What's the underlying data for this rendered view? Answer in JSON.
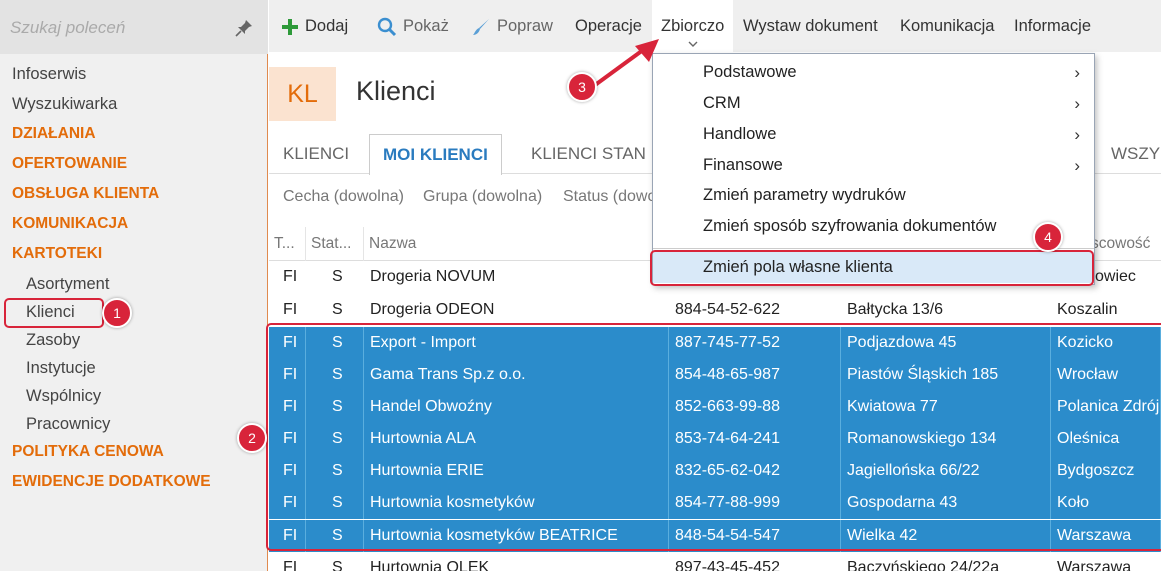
{
  "search": {
    "placeholder": "Szukaj poleceń"
  },
  "sidebar": {
    "items": [
      {
        "label": "Infoserwis"
      },
      {
        "label": "Wyszukiwarka"
      },
      {
        "label": "DZIAŁANIA"
      },
      {
        "label": "OFERTOWANIE"
      },
      {
        "label": "OBSŁUGA KLIENTA"
      },
      {
        "label": "KOMUNIKACJA"
      },
      {
        "label": "KARTOTEKI"
      },
      {
        "label": "Asortyment"
      },
      {
        "label": "Klienci"
      },
      {
        "label": "Zasoby"
      },
      {
        "label": "Instytucje"
      },
      {
        "label": "Wspólnicy"
      },
      {
        "label": "Pracownicy"
      },
      {
        "label": "POLITYKA CENOWA"
      },
      {
        "label": "EWIDENCJE DODATKOWE"
      }
    ]
  },
  "toolbar": {
    "dodaj": "Dodaj",
    "pokaz": "Pokaż",
    "popraw": "Popraw",
    "operacje": "Operacje",
    "zbiorczo": "Zbiorczo",
    "wystaw": "Wystaw dokument",
    "komunikacja": "Komunikacja",
    "informacje": "Informacje"
  },
  "header": {
    "badge": "KL",
    "title": "Klienci"
  },
  "tabs": [
    {
      "label": "KLIENCI"
    },
    {
      "label": "MOI KLIENCI"
    },
    {
      "label": "KLIENCI STAN"
    },
    {
      "label": "WSZY"
    }
  ],
  "filters": [
    {
      "label": "Cecha (dowolna)"
    },
    {
      "label": "Grupa (dowolna)"
    },
    {
      "label": "Status (dowo"
    }
  ],
  "grid": {
    "columns": [
      "T...",
      "Stat...",
      "Nazwa",
      "",
      "",
      "scowość"
    ],
    "rows": [
      {
        "typ": "FI",
        "status": "S",
        "nazwa": "Drogeria NOVUM",
        "nip": "",
        "adres": "",
        "miejscowosc": "owiec"
      },
      {
        "typ": "FI",
        "status": "S",
        "nazwa": "Drogeria ODEON",
        "nip": "884-54-52-622",
        "adres": "Bałtycka  13/6",
        "miejscowosc": "Koszalin"
      },
      {
        "typ": "FI",
        "status": "S",
        "nazwa": "Export - Import",
        "nip": "887-745-77-52",
        "adres": "Podjazdowa 45",
        "miejscowosc": "Kozicko"
      },
      {
        "typ": "FI",
        "status": "S",
        "nazwa": "Gama Trans Sp.z o.o.",
        "nip": "854-48-65-987",
        "adres": "Piastów Śląskich 185",
        "miejscowosc": "Wrocław"
      },
      {
        "typ": "FI",
        "status": "S",
        "nazwa": "Handel Obwoźny",
        "nip": "852-663-99-88",
        "adres": "Kwiatowa  77",
        "miejscowosc": "Polanica Zdrój"
      },
      {
        "typ": "FI",
        "status": "S",
        "nazwa": "Hurtownia ALA",
        "nip": "853-74-64-241",
        "adres": "Romanowskiego 134",
        "miejscowosc": "Oleśnica"
      },
      {
        "typ": "FI",
        "status": "S",
        "nazwa": "Hurtownia ERIE",
        "nip": "832-65-62-042",
        "adres": "Jagiellońska  66/22",
        "miejscowosc": "Bydgoszcz"
      },
      {
        "typ": "FI",
        "status": "S",
        "nazwa": "Hurtownia kosmetyków",
        "nip": "854-77-88-999",
        "adres": "Gospodarna  43",
        "miejscowosc": "Koło"
      },
      {
        "typ": "FI",
        "status": "S",
        "nazwa": "Hurtownia kosmetyków BEATRICE",
        "nip": "848-54-54-547",
        "adres": "Wielka  42",
        "miejscowosc": "Warszawa"
      },
      {
        "typ": "FI",
        "status": "S",
        "nazwa": "Hurtownia OLEK",
        "nip": "897-43-45-452",
        "adres": "Baczyńskiego  24/22a",
        "miejscowosc": "Warszawa"
      }
    ]
  },
  "menu": {
    "items": [
      {
        "label": "Podstawowe",
        "arrow": "›"
      },
      {
        "label": "CRM",
        "arrow": "›"
      },
      {
        "label": "Handlowe",
        "arrow": "›"
      },
      {
        "label": "Finansowe",
        "arrow": "›"
      },
      {
        "label": "Zmień parametry wydruków",
        "arrow": ""
      },
      {
        "label": "Zmień sposób szyfrowania dokumentów",
        "arrow": ""
      },
      {
        "label": "Zmień pola własne klienta",
        "arrow": ""
      }
    ]
  },
  "markers": [
    "1",
    "2",
    "3",
    "4"
  ],
  "colors": {
    "accent": "#e36c0a",
    "selection": "#2b8ccb",
    "annotation": "#d8243a",
    "tab_active": "#2a7bbf"
  }
}
